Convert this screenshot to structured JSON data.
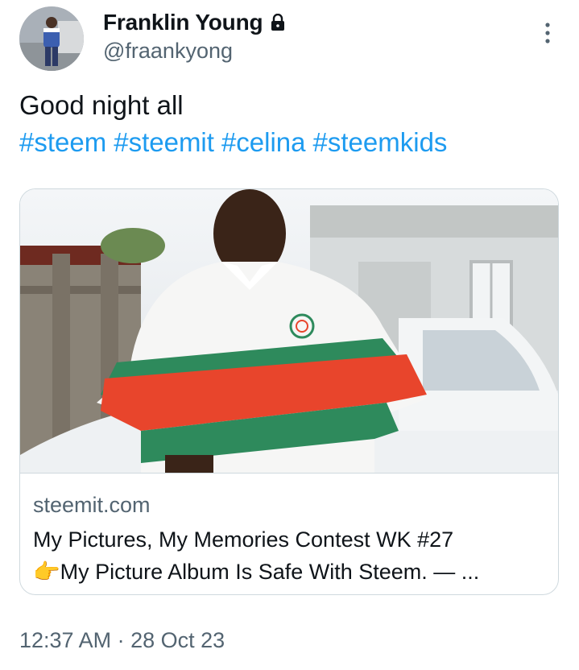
{
  "author": {
    "display_name": "Franklin Young",
    "handle": "@fraankyong",
    "avatar_icon": "avatar",
    "protected_icon": "lock-icon"
  },
  "tweet": {
    "text": "Good night all",
    "hashtags": [
      "#steem",
      "#steemit",
      "#celina",
      "#steemkids"
    ]
  },
  "link_card": {
    "domain": "steemit.com",
    "title_line1": "My Pictures, My Memories Contest WK #27",
    "title_line2": "My Picture Album Is Safe With Steem. — ...",
    "title_emoji": "👉"
  },
  "meta": {
    "timestamp": "12:37 AM · 28 Oct 23"
  },
  "colors": {
    "link": "#1d9bf0",
    "secondary_text": "#536471",
    "border": "#cfd9de"
  }
}
